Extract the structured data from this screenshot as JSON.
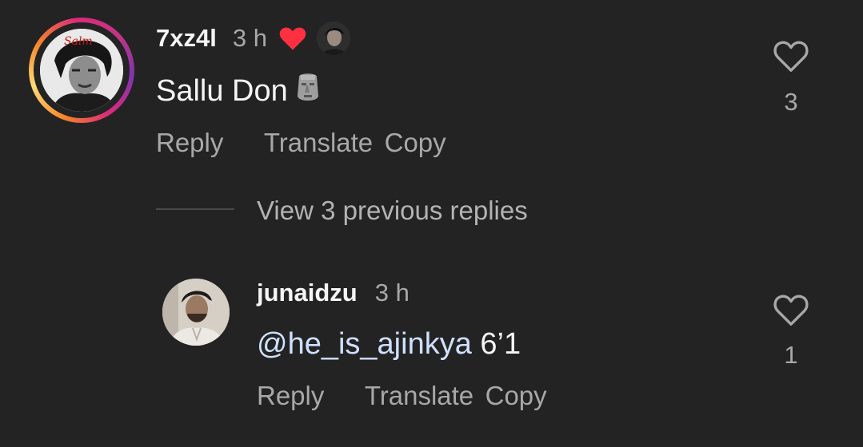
{
  "comments": [
    {
      "username": "7xz4l",
      "time": "3 h",
      "text": "Sallu Don",
      "emoji": "moai",
      "actions": {
        "reply": "Reply",
        "translate": "Translate",
        "copy": "Copy"
      },
      "likes": "3",
      "liked_by_author_badge": "red-heart-icon"
    },
    {
      "username": "junaidzu",
      "time": "3 h",
      "mention": "@he_is_ajinkya",
      "text": "6’1",
      "actions": {
        "reply": "Reply",
        "translate": "Translate",
        "copy": "Copy"
      },
      "likes": "1"
    }
  ],
  "view_replies": "View 3 previous replies",
  "colors": {
    "background": "#232323",
    "primary_text": "#f5f5f5",
    "secondary_text": "#a8a8a8",
    "heart_red": "#ff3040",
    "mention": "#cfe0ff"
  }
}
